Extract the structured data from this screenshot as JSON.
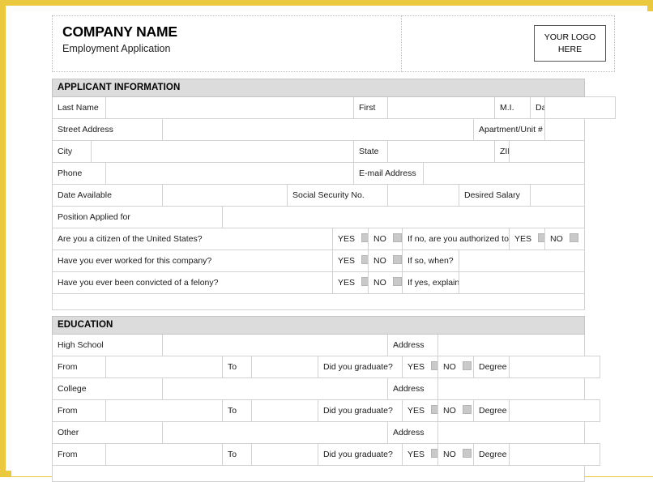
{
  "header": {
    "company_name": "COMPANY NAME",
    "subtitle": "Employment Application",
    "logo_line1": "YOUR LOGO",
    "logo_line2": "HERE"
  },
  "colors": {
    "page_frame": "#EBC93F",
    "section_header_bg": "#dcdcdc",
    "grid_line": "#d2d2d2",
    "checkbox_fill": "#c9c9c9"
  },
  "sections": {
    "applicant": {
      "title": "APPLICANT INFORMATION",
      "labels": {
        "last_name": "Last Name",
        "first": "First",
        "mi": "M.I.",
        "date": "Date",
        "street_address": "Street Address",
        "apartment_unit": "Apartment/Unit #",
        "city": "City",
        "state": "State",
        "zip": "ZIP",
        "phone": "Phone",
        "email": "E-mail Address",
        "date_available": "Date Available",
        "ssn": "Social Security No.",
        "desired_salary": "Desired Salary",
        "position_applied_for": "Position Applied for"
      },
      "questions": [
        {
          "text": "Are you a citizen of the United States?",
          "yes": "YES",
          "no": "NO",
          "followup": "If no, are you authorized to work in the U.S.?",
          "followup_yes": "YES",
          "followup_no": "NO"
        },
        {
          "text": "Have you ever worked for this company?",
          "yes": "YES",
          "no": "NO",
          "followup": "If so, when?"
        },
        {
          "text": "Have you ever been convicted of a felony?",
          "yes": "YES",
          "no": "NO",
          "followup": "If yes, explain"
        }
      ]
    },
    "education": {
      "title": "EDUCATION",
      "labels": {
        "address": "Address",
        "from": "From",
        "to": "To",
        "did_you_graduate": "Did you graduate?",
        "yes": "YES",
        "no": "NO",
        "degree": "Degree"
      },
      "entries": [
        {
          "name": "High School"
        },
        {
          "name": "College"
        },
        {
          "name": "Other"
        }
      ]
    }
  }
}
